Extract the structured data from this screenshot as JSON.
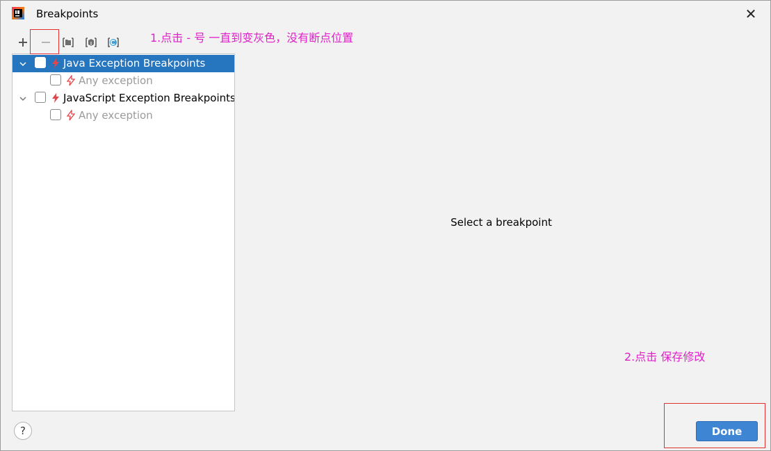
{
  "window": {
    "title": "Breakpoints",
    "close_glyph": "✕"
  },
  "toolbar": {
    "add_glyph": "+",
    "items": [
      {
        "name": "add-icon",
        "enabled": true
      },
      {
        "name": "remove-icon",
        "enabled": false
      },
      {
        "name": "group-folder-icon",
        "enabled": true
      },
      {
        "name": "group-package-icon",
        "enabled": true
      },
      {
        "name": "group-class-icon",
        "enabled": true
      }
    ]
  },
  "tree": {
    "items": [
      {
        "label": "Java Exception Breakpoints",
        "level": 0,
        "expanded": true,
        "selected": true,
        "checked": false
      },
      {
        "label": "Any exception",
        "level": 1,
        "disabled": true,
        "checked": false
      },
      {
        "label": "JavaScript Exception Breakpoints",
        "level": 0,
        "expanded": true,
        "selected": false,
        "checked": false
      },
      {
        "label": "Any exception",
        "level": 1,
        "disabled": true,
        "checked": false
      }
    ]
  },
  "detail": {
    "placeholder": "Select a breakpoint"
  },
  "annotations": {
    "step1": "1.点击 - 号 一直到变灰色，没有断点位置",
    "step2": "2.点击 保存修改",
    "color": "#e020c8",
    "box_color": "#e03030"
  },
  "footer": {
    "help_glyph": "?",
    "done_label": "Done"
  },
  "colors": {
    "selection": "#2675bf",
    "bolt": "#e0474c",
    "done_button": "#3e86d4"
  }
}
